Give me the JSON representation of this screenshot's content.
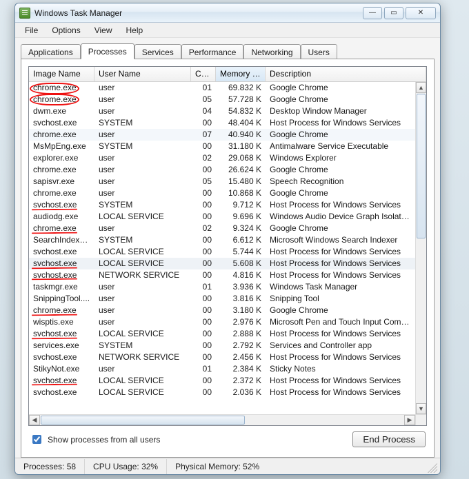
{
  "window": {
    "title": "Windows Task Manager"
  },
  "menu": {
    "file": "File",
    "options": "Options",
    "view": "View",
    "help": "Help"
  },
  "tabs": {
    "applications": "Applications",
    "processes": "Processes",
    "services": "Services",
    "performance": "Performance",
    "networking": "Networking",
    "users": "Users"
  },
  "columns": {
    "image": "Image Name",
    "user": "User Name",
    "cpu": "CPU",
    "memory": "Memory (...",
    "description": "Description"
  },
  "rows": [
    {
      "img": "chrome.exe",
      "user": "user",
      "cpu": "01",
      "mem": "69.832 K",
      "desc": "Google Chrome"
    },
    {
      "img": "chrome.exe",
      "user": "user",
      "cpu": "05",
      "mem": "57.728 K",
      "desc": "Google Chrome"
    },
    {
      "img": "dwm.exe",
      "user": "user",
      "cpu": "04",
      "mem": "54.832 K",
      "desc": "Desktop Window Manager"
    },
    {
      "img": "svchost.exe",
      "user": "SYSTEM",
      "cpu": "00",
      "mem": "48.404 K",
      "desc": "Host Process for Windows Services"
    },
    {
      "img": "chrome.exe",
      "user": "user",
      "cpu": "07",
      "mem": "40.940 K",
      "desc": "Google Chrome"
    },
    {
      "img": "MsMpEng.exe",
      "user": "SYSTEM",
      "cpu": "00",
      "mem": "31.180 K",
      "desc": "Antimalware Service Executable"
    },
    {
      "img": "explorer.exe",
      "user": "user",
      "cpu": "02",
      "mem": "29.068 K",
      "desc": "Windows Explorer"
    },
    {
      "img": "chrome.exe",
      "user": "user",
      "cpu": "00",
      "mem": "26.624 K",
      "desc": "Google Chrome"
    },
    {
      "img": "sapisvr.exe",
      "user": "user",
      "cpu": "05",
      "mem": "15.480 K",
      "desc": "Speech Recognition"
    },
    {
      "img": "chrome.exe",
      "user": "user",
      "cpu": "00",
      "mem": "10.868 K",
      "desc": "Google Chrome"
    },
    {
      "img": "svchost.exe",
      "user": "SYSTEM",
      "cpu": "00",
      "mem": "9.712 K",
      "desc": "Host Process for Windows Services"
    },
    {
      "img": "audiodg.exe",
      "user": "LOCAL SERVICE",
      "cpu": "00",
      "mem": "9.696 K",
      "desc": "Windows Audio Device Graph Isolation"
    },
    {
      "img": "chrome.exe",
      "user": "user",
      "cpu": "02",
      "mem": "9.324 K",
      "desc": "Google Chrome"
    },
    {
      "img": "SearchIndexe...",
      "user": "SYSTEM",
      "cpu": "00",
      "mem": "6.612 K",
      "desc": "Microsoft Windows Search Indexer"
    },
    {
      "img": "svchost.exe",
      "user": "LOCAL SERVICE",
      "cpu": "00",
      "mem": "5.744 K",
      "desc": "Host Process for Windows Services"
    },
    {
      "img": "svchost.exe",
      "user": "LOCAL SERVICE",
      "cpu": "00",
      "mem": "5.608 K",
      "desc": "Host Process for Windows Services"
    },
    {
      "img": "svchost.exe",
      "user": "NETWORK SERVICE",
      "cpu": "00",
      "mem": "4.816 K",
      "desc": "Host Process for Windows Services"
    },
    {
      "img": "taskmgr.exe",
      "user": "user",
      "cpu": "01",
      "mem": "3.936 K",
      "desc": "Windows Task Manager"
    },
    {
      "img": "SnippingTool....",
      "user": "user",
      "cpu": "00",
      "mem": "3.816 K",
      "desc": "Snipping Tool"
    },
    {
      "img": "chrome.exe",
      "user": "user",
      "cpu": "00",
      "mem": "3.180 K",
      "desc": "Google Chrome"
    },
    {
      "img": "wisptis.exe",
      "user": "user",
      "cpu": "00",
      "mem": "2.976 K",
      "desc": "Microsoft Pen and Touch Input Component"
    },
    {
      "img": "svchost.exe",
      "user": "LOCAL SERVICE",
      "cpu": "00",
      "mem": "2.888 K",
      "desc": "Host Process for Windows Services"
    },
    {
      "img": "services.exe",
      "user": "SYSTEM",
      "cpu": "00",
      "mem": "2.792 K",
      "desc": "Services and Controller app"
    },
    {
      "img": "svchost.exe",
      "user": "NETWORK SERVICE",
      "cpu": "00",
      "mem": "2.456 K",
      "desc": "Host Process for Windows Services"
    },
    {
      "img": "StikyNot.exe",
      "user": "user",
      "cpu": "01",
      "mem": "2.384 K",
      "desc": "Sticky Notes"
    },
    {
      "img": "svchost.exe",
      "user": "LOCAL SERVICE",
      "cpu": "00",
      "mem": "2.372 K",
      "desc": "Host Process for Windows Services"
    },
    {
      "img": "svchost.exe",
      "user": "LOCAL SERVICE",
      "cpu": "00",
      "mem": "2.036 K",
      "desc": "Host Process for Windows Services"
    }
  ],
  "selected_row_index": 4,
  "hover_row_index": 15,
  "checkbox": {
    "label": "Show processes from all users",
    "checked": true
  },
  "buttons": {
    "end_process": "End Process"
  },
  "status": {
    "processes": "Processes: 58",
    "cpu": "CPU Usage: 32%",
    "memory": "Physical Memory: 52%"
  },
  "winbtn": {
    "min": "—",
    "max": "▭",
    "close": "✕"
  }
}
